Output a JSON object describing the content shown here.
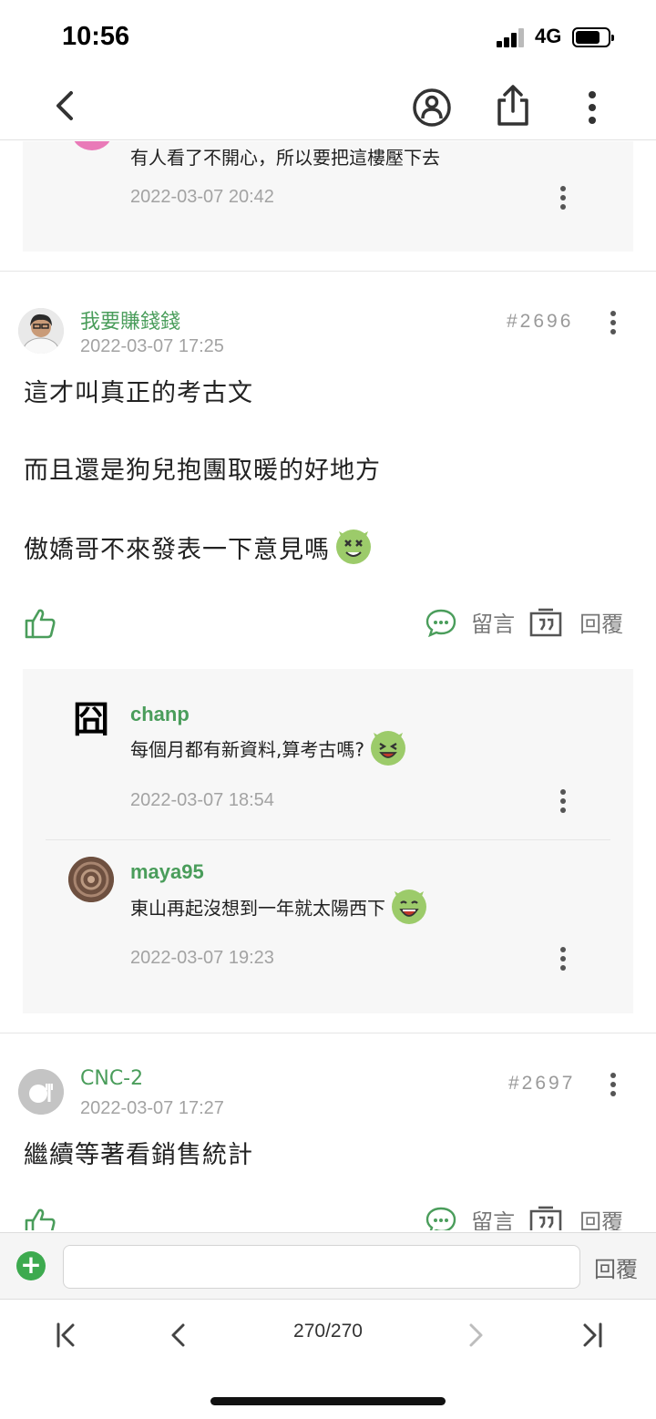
{
  "status": {
    "time": "10:56",
    "network": "4G"
  },
  "nav": {
    "back": "back-icon",
    "user": "user-circle-icon",
    "share": "share-icon",
    "more": "more-vertical-icon"
  },
  "prev_comment": {
    "text": "有人看了不開心，所以要把這樓壓下去",
    "date": "2022-03-07 20:42"
  },
  "posts": [
    {
      "author": "我要賺錢錢",
      "date": "2022-03-07 17:25",
      "floor": "#2696",
      "lines": [
        "這才叫真正的考古文",
        "而且還是狗兒抱團取暖的好地方",
        "傲嬌哥不來發表一下意見嗎"
      ],
      "comment_label": "留言",
      "reply_label": "回覆",
      "comments": [
        {
          "author": "chanp",
          "text": "每個月都有新資料,算考古嗎?",
          "date": "2022-03-07 18:54",
          "avatar_char": "囧"
        },
        {
          "author": "maya95",
          "text": "東山再起沒想到一年就太陽西下",
          "date": "2022-03-07 19:23"
        }
      ]
    },
    {
      "author": "CNC-2",
      "date": "2022-03-07 17:27",
      "floor": "#2697",
      "lines": [
        "繼續等著看銷售統計"
      ],
      "comment_label": "留言",
      "reply_label": "回覆"
    }
  ],
  "replybar": {
    "placeholder": "",
    "send_label": "回覆"
  },
  "pager": {
    "current": "270/270"
  },
  "colors": {
    "accent": "#4a9d5b",
    "muted": "#a3a3a3"
  }
}
